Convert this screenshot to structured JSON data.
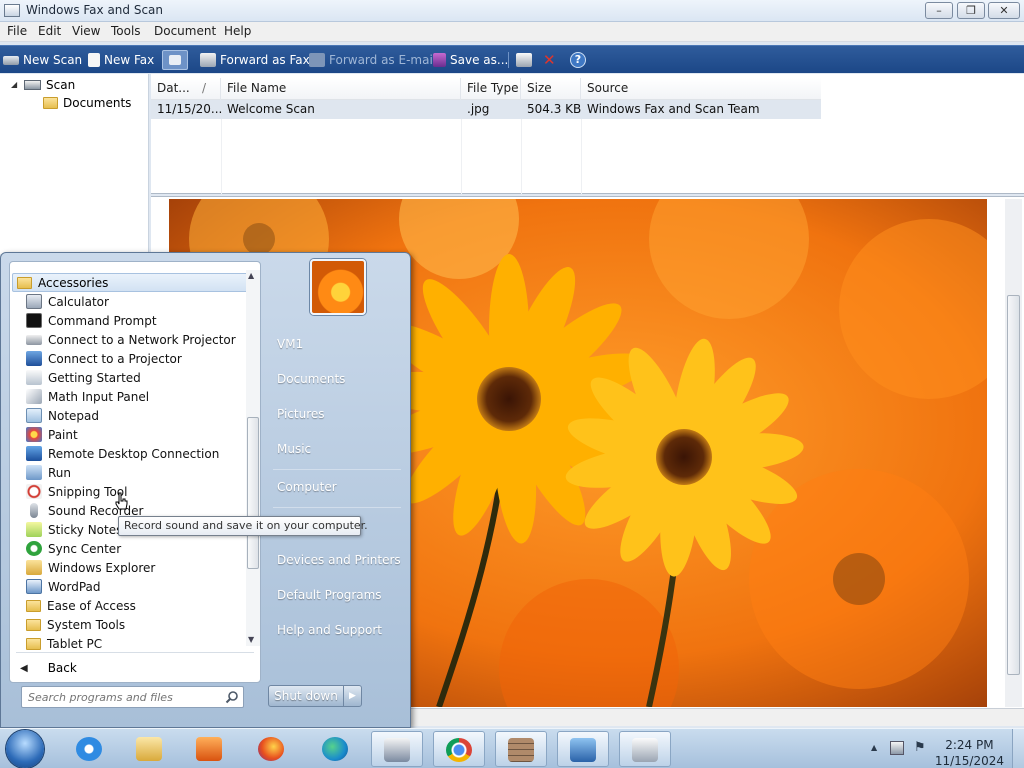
{
  "window": {
    "title": "Windows Fax and Scan",
    "menu": [
      "File",
      "Edit",
      "View",
      "Tools",
      "Document",
      "Help"
    ]
  },
  "toolbar": {
    "new_scan": "New Scan",
    "new_fax": "New Fax",
    "forward_fax": "Forward as Fax",
    "forward_email": "Forward as E-mail",
    "save_as": "Save as..."
  },
  "tree": {
    "scan": "Scan",
    "documents": "Documents"
  },
  "filelist": {
    "columns": [
      "Dat...",
      "File Name",
      "File Type",
      "Size",
      "Source"
    ],
    "rows": [
      {
        "date": "11/15/20...",
        "name": "Welcome Scan",
        "type": ".jpg",
        "size": "504.3 KB",
        "source": "Windows Fax and Scan Team"
      }
    ]
  },
  "start_menu": {
    "folder": "Accessories",
    "items": [
      "Calculator",
      "Command Prompt",
      "Connect to a Network Projector",
      "Connect to a Projector",
      "Getting Started",
      "Math Input Panel",
      "Notepad",
      "Paint",
      "Remote Desktop Connection",
      "Run",
      "Snipping Tool",
      "Sound Recorder",
      "Sticky Notes",
      "Sync Center",
      "Windows Explorer",
      "WordPad",
      "Ease of Access",
      "System Tools",
      "Tablet PC"
    ],
    "back": "Back",
    "search_placeholder": "Search programs and files",
    "right_links": [
      "VM1",
      "Documents",
      "Pictures",
      "Music",
      "Computer",
      "Devices and Printers",
      "Default Programs",
      "Help and Support"
    ],
    "shutdown": "Shut down",
    "tooltip": "Record sound and save it on your computer."
  },
  "taskbar": {
    "time": "2:24 PM",
    "date": "11/15/2024"
  },
  "colors": {
    "toolbar": "#1c4787",
    "selection": "#dfe6ef",
    "flower_orange": "#ff8a14"
  }
}
